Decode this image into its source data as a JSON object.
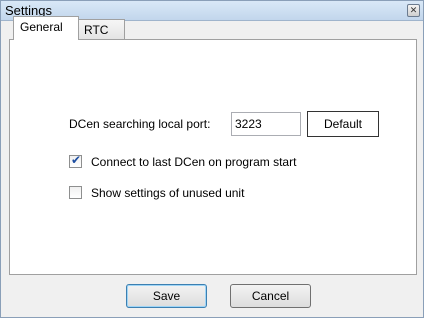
{
  "window": {
    "title": "Settings",
    "close_icon": "close-icon"
  },
  "tabs": [
    {
      "label": "General",
      "active": true
    },
    {
      "label": "RTC",
      "active": false
    }
  ],
  "general": {
    "port_label": "DCen searching local port:",
    "port_value": "3223",
    "default_label": "Default",
    "connect_last_label": "Connect to last DCen on program start",
    "connect_last_checked": true,
    "show_unused_label": "Show settings of unused unit",
    "show_unused_checked": false
  },
  "footer": {
    "save_label": "Save",
    "cancel_label": "Cancel"
  },
  "colors": {
    "accent": "#3c7fb1",
    "check": "#1c4da0"
  }
}
